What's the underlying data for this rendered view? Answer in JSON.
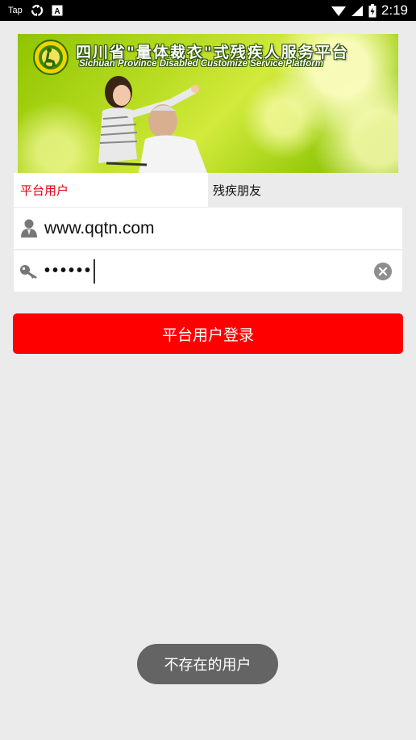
{
  "status_bar": {
    "left_text": "Tap",
    "time": "2:19",
    "icons": [
      "sync-icon",
      "translate-a-icon",
      "wifi-icon",
      "signal-icon",
      "battery-icon"
    ]
  },
  "banner": {
    "title": "四川省\"量体裁衣\"式残疾人服务平台",
    "subtitle": "Sichuan Province Disabled Customize Service Platform"
  },
  "tabs": [
    {
      "label": "平台用户",
      "active": true
    },
    {
      "label": "残疾朋友",
      "active": false
    }
  ],
  "login_form": {
    "username_value": "www.qqtn.com",
    "password_mask": "••••••",
    "login_button_label": "平台用户登录"
  },
  "toast": {
    "message": "不存在的用户"
  },
  "colors": {
    "accent_red": "#ff0000",
    "active_tab_text": "#e60012",
    "background": "#ebebeb",
    "toast_bg": "#646464"
  }
}
